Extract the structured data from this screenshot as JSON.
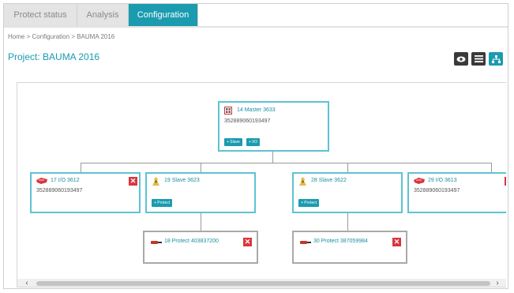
{
  "tabs": [
    {
      "label": "Protect status"
    },
    {
      "label": "Analysis"
    },
    {
      "label": "Configuration"
    }
  ],
  "breadcrumb": {
    "home": "Home",
    "configuration": "Configuration",
    "current": "BAUMA 2016",
    "separator": ">"
  },
  "page": {
    "title": "Project: BAUMA 2016"
  },
  "view_buttons": [
    {
      "icon": "eye-icon"
    },
    {
      "icon": "list-icon"
    },
    {
      "icon": "hierarchy-icon"
    }
  ],
  "nodes": {
    "master": {
      "title": "14 Master 3633",
      "serial": "352889060193497",
      "add_slave": "+ Slave",
      "add_io": "+ I/O",
      "icon": "master-module-icon"
    },
    "io_left": {
      "title": "17 I/O 3612",
      "serial": "352889060193497",
      "icon": "io-module-icon"
    },
    "slave_left": {
      "title": "19 Slave 3623",
      "add_protect": "+ Protect",
      "icon": "slave-module-icon"
    },
    "slave_right": {
      "title": "28 Slave 3622",
      "add_protect": "+ Protect",
      "icon": "slave-module-icon"
    },
    "io_right": {
      "title": "29 I/O 3613",
      "serial": "352889060193497",
      "icon": "io-module-icon"
    },
    "protect_left": {
      "title": "18 Protect 403837200",
      "icon": "protect-sensor-icon"
    },
    "protect_right": {
      "title": "30 Protect 387059984",
      "icon": "protect-sensor-icon"
    }
  },
  "colors": {
    "accent": "#1a9bb0",
    "node_border": "#5ec2d3",
    "delete": "#d9363e",
    "dark": "#3a3a3a"
  }
}
